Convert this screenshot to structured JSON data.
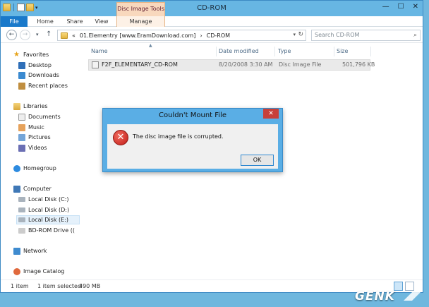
{
  "window": {
    "title": "CD-ROM",
    "controls": {
      "minimize": "—",
      "maximize": "☐",
      "close": "✕"
    }
  },
  "ribbon": {
    "tabs": [
      "File",
      "Home",
      "Share",
      "View"
    ],
    "contextual_group": "Disc Image Tools",
    "contextual_tab": "Manage"
  },
  "address": {
    "prefix": "«",
    "segment1": "01.Elementry [www.EramDownload.com]",
    "separator": "›",
    "segment2": "CD-ROM",
    "search_placeholder": "Search CD-ROM"
  },
  "nav": {
    "favorites": "Favorites",
    "favorites_items": [
      "Desktop",
      "Downloads",
      "Recent places"
    ],
    "libraries": "Libraries",
    "libraries_items": [
      "Documents",
      "Music",
      "Pictures",
      "Videos"
    ],
    "homegroup": "Homegroup",
    "computer": "Computer",
    "computer_items": [
      "Local Disk (C:)",
      "Local Disk (D:)",
      "Local Disk (E:)",
      "BD-ROM Drive (("
    ],
    "network": "Network",
    "image_catalog": "Image Catalog"
  },
  "columns": {
    "name": "Name",
    "date": "Date modified",
    "type": "Type",
    "size": "Size"
  },
  "files": [
    {
      "name": "F2F_ELEMENTARY_CD-ROM",
      "date": "8/20/2008 3:30 AM",
      "type": "Disc Image File",
      "size": "501,796 KB"
    }
  ],
  "status": {
    "count": "1 item",
    "selected": "1 item selected",
    "size": "490 MB"
  },
  "dialog": {
    "title": "Couldn't Mount File",
    "message": "The disc image file is corrupted.",
    "ok": "OK",
    "close": "✕"
  },
  "watermark": "GENK",
  "colors": {
    "accent": "#1979ca",
    "titlebar": "#67b6e3",
    "context": "#f8d8bd",
    "error": "#c11b16",
    "close": "#c7403a"
  }
}
